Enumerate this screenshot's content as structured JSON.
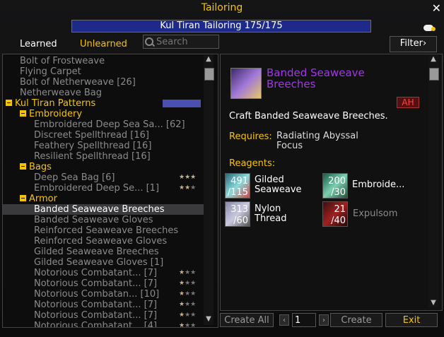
{
  "window": {
    "title": "Tailoring",
    "close_glyph": "✕"
  },
  "skill": {
    "label": "Kul Tiran Tailoring 175/175",
    "current": 175,
    "max": 175
  },
  "tabs": {
    "learned": "Learned",
    "unlearned": "Unlearned"
  },
  "search": {
    "placeholder": "Search"
  },
  "filter": {
    "label": "Filter",
    "glyph": "›"
  },
  "list": [
    {
      "type": "recipe",
      "indent": 0,
      "text": "Bolt of Frostweave"
    },
    {
      "type": "recipe",
      "indent": 0,
      "text": "Flying Carpet"
    },
    {
      "type": "recipe",
      "indent": 0,
      "text": "Bolt of Netherweave [26]"
    },
    {
      "type": "recipe",
      "indent": 0,
      "text": "Netherweave Bag"
    },
    {
      "type": "category",
      "indent": 0,
      "text": "Kul Tiran Patterns",
      "progress": true
    },
    {
      "type": "category",
      "indent": 1,
      "text": "Embroidery"
    },
    {
      "type": "recipe",
      "indent": 2,
      "text": "Embroidered Deep Sea Sa... [62]"
    },
    {
      "type": "recipe",
      "indent": 2,
      "text": "Discreet Spellthread [16]"
    },
    {
      "type": "recipe",
      "indent": 2,
      "text": "Feathery Spellthread [16]"
    },
    {
      "type": "recipe",
      "indent": 2,
      "text": "Resilient Spellthread [16]"
    },
    {
      "type": "category",
      "indent": 1,
      "text": "Bags"
    },
    {
      "type": "recipe",
      "indent": 2,
      "text": "Deep Sea Bag [6]",
      "stars": 3
    },
    {
      "type": "recipe",
      "indent": 2,
      "text": "Embroidered Deep Se... [1]",
      "stars": 2
    },
    {
      "type": "category",
      "indent": 1,
      "text": "Armor"
    },
    {
      "type": "recipe",
      "indent": 2,
      "text": "Banded Seaweave Breeches",
      "selected": true
    },
    {
      "type": "recipe",
      "indent": 2,
      "text": "Banded Seaweave Gloves"
    },
    {
      "type": "recipe",
      "indent": 2,
      "text": "Reinforced Seaweave Breeches"
    },
    {
      "type": "recipe",
      "indent": 2,
      "text": "Reinforced Seaweave Gloves"
    },
    {
      "type": "recipe",
      "indent": 2,
      "text": "Gilded Seaweave Breeches"
    },
    {
      "type": "recipe",
      "indent": 2,
      "text": "Gilded Seaweave Gloves [1]"
    },
    {
      "type": "recipe",
      "indent": 2,
      "text": "Notorious Combatant... [7]",
      "stars": 1
    },
    {
      "type": "recipe",
      "indent": 2,
      "text": "Notorious Combatant... [7]",
      "stars": 1
    },
    {
      "type": "recipe",
      "indent": 2,
      "text": "Notorious Combatan... [10]",
      "stars": 1
    },
    {
      "type": "recipe",
      "indent": 2,
      "text": "Notorious Combatant... [7]",
      "stars": 1
    },
    {
      "type": "recipe",
      "indent": 2,
      "text": "Notorious Combatant... [7]",
      "stars": 1
    },
    {
      "type": "recipe",
      "indent": 2,
      "text": "Notorious Combatant... [4]",
      "stars": 1
    }
  ],
  "detail": {
    "name": "Banded Seaweave Breeches",
    "ah": "AH",
    "description": "Craft Banded Seaweave Breeches.",
    "requires_label": "Requires:",
    "requires_value": "Radiating Abyssal Focus",
    "reagents_label": "Reagents:",
    "reagents": [
      {
        "name": "Gilded Seaweave",
        "have": "491",
        "need": "/115",
        "color": "#ffffff"
      },
      {
        "name": "Embroide...",
        "have": "200",
        "need": "/30",
        "color": "#ffffff"
      },
      {
        "name": "Nylon Thread",
        "have": "313",
        "need": "/60",
        "color": "#ffffff"
      },
      {
        "name": "Expulsom",
        "have": "21",
        "need": "/40",
        "color": "#8a8a8a"
      }
    ]
  },
  "footer": {
    "create_all": "Create All",
    "quantity": "1",
    "create": "Create",
    "exit": "Exit",
    "left_arrow": "‹",
    "right_arrow": "›"
  },
  "colors": {
    "accent": "#f5c400",
    "epic": "#a335ee",
    "skillbar": "#1e2a8a"
  }
}
